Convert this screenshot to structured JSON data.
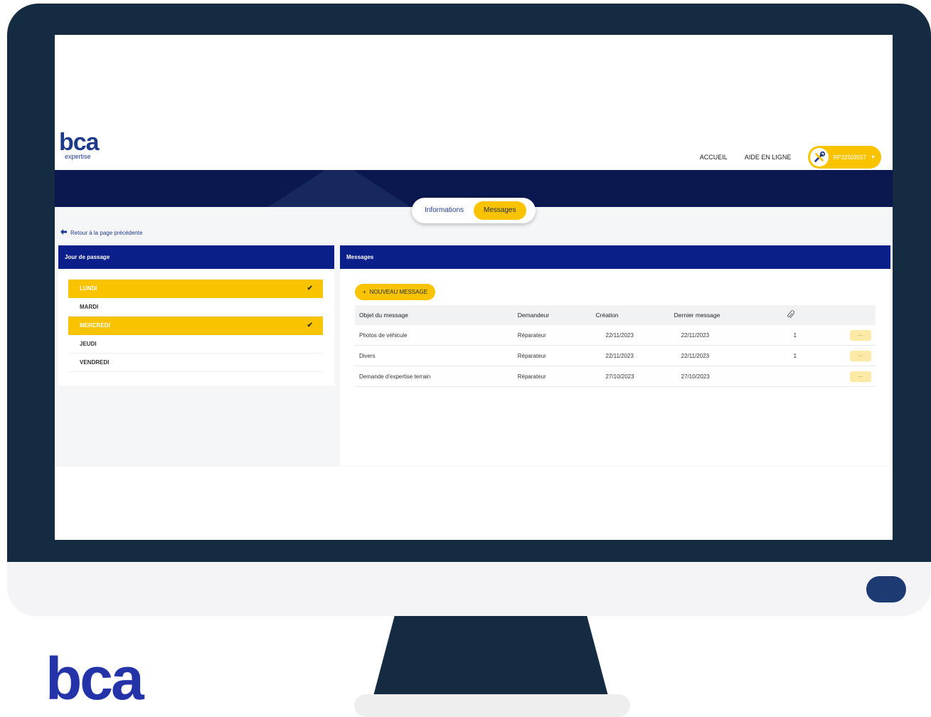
{
  "brand": {
    "logo_text": "bca",
    "logo_subtext": "expertise",
    "footer_logo_text": "bca",
    "accent": "#f9c300",
    "navy": "#0b1850"
  },
  "nav": {
    "home": "ACCUEIL",
    "help": "AIDE EN LIGNE",
    "user_id": "RP32503557",
    "user_icon": "tools-icon"
  },
  "tabs": [
    {
      "label": "Informations",
      "active": false
    },
    {
      "label": "Messages",
      "active": true
    }
  ],
  "back_link": "Retour à la page précédente",
  "days_panel": {
    "title": "Jour de passage",
    "days": [
      {
        "label": "LUNDI",
        "selected": true
      },
      {
        "label": "MARDI",
        "selected": false
      },
      {
        "label": "MERCREDI",
        "selected": true
      },
      {
        "label": "JEUDI",
        "selected": false
      },
      {
        "label": "VENDREDI",
        "selected": false
      }
    ]
  },
  "messages_panel": {
    "title": "Messages",
    "new_button": "NOUVEAU MESSAGE",
    "columns": [
      "Objet du message",
      "Demandeur",
      "Création",
      "Dernier message"
    ],
    "attachment_icon": "paperclip-icon",
    "rows": [
      {
        "subject": "Photos de véhicule",
        "requester": "Réparateur",
        "created": "22/11/2023",
        "last": "22/11/2023",
        "attachments": "1",
        "action": "..."
      },
      {
        "subject": "Divers",
        "requester": "Réparateur",
        "created": "22/11/2023",
        "last": "22/11/2023",
        "attachments": "1",
        "action": "..."
      },
      {
        "subject": "Demande d'expertise terrain",
        "requester": "Réparateur",
        "created": "27/10/2023",
        "last": "27/10/2023",
        "attachments": "",
        "action": "..."
      }
    ]
  }
}
